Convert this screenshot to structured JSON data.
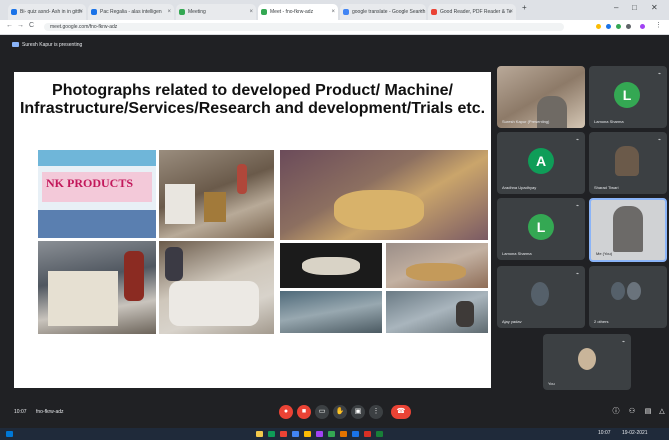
{
  "browser": {
    "tabs": [
      {
        "label": "Bi- quiz asnd- Ash in in gitth",
        "color": "#1a73e8"
      },
      {
        "label": "Pac Regalia - alas intelligen",
        "color": "#1a73e8"
      },
      {
        "label": "Meeting",
        "color": "#34a853"
      },
      {
        "label": "Meet - fno-fkrw-adz",
        "color": "#34a853"
      },
      {
        "label": "google translate - Google Search",
        "color": "#4285f4"
      },
      {
        "label": "Good Reader, PDF Reader & Te",
        "color": "#ea4335"
      }
    ],
    "url": "meet.google.com/fno-fkrw-adz",
    "nav": {
      "back": "←",
      "forward": "→",
      "reload": "C"
    },
    "window": {
      "minimize": "–",
      "maximize": "□",
      "close": "✕"
    }
  },
  "meet": {
    "presenting_label": "Suresh Kapur is presenting",
    "slide_title": "Photographs related to developed Product/ Machine/ Infrastructure/Services/Research and development/Trials etc.",
    "product_banner": "NK PRODUCTS",
    "participants": [
      {
        "name": "Suresh Kapur (Presenting)",
        "type": "video",
        "color": "#7d6a55"
      },
      {
        "name": "Lamona Sharma",
        "type": "avatar",
        "initial": "L",
        "color": "#34a853"
      },
      {
        "name": "Aradhna Upadhyay",
        "type": "avatar",
        "initial": "A",
        "color": "#0f9d58"
      },
      {
        "name": "Sharad Tiwari",
        "type": "photo",
        "color": "#6b5a4a"
      },
      {
        "name": "Lamona Sharma",
        "type": "avatar",
        "initial": "L",
        "color": "#34a853"
      },
      {
        "name": "Me (You)",
        "type": "photo",
        "color": "#8a8a8a"
      },
      {
        "name": "Ajay yadav",
        "type": "photo",
        "color": "#55606a"
      },
      {
        "name": "2 others",
        "type": "photo",
        "color": "#55606a"
      },
      {
        "name": "You",
        "type": "photo",
        "color": "#c9b59a"
      }
    ],
    "time": "10:07",
    "meeting_code": "fno-fkrw-adz"
  },
  "taskbar": {
    "time": "10:07",
    "date": "19-02-2021"
  }
}
